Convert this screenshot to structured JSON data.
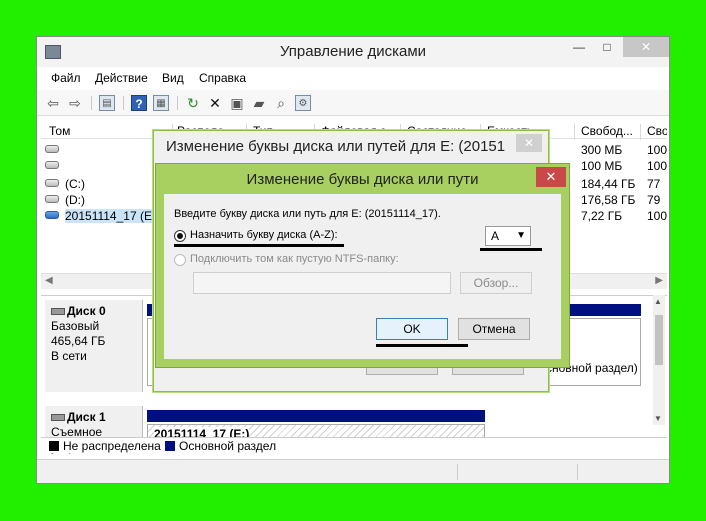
{
  "main_window": {
    "title": "Управление дисками",
    "menu": [
      "Файл",
      "Действие",
      "Вид",
      "Справка"
    ],
    "columns": [
      "Том",
      "Располо",
      "Тип",
      "Файловая с",
      "Состояние",
      "Емкость",
      "Свобод...",
      "Сво"
    ],
    "volumes": [
      {
        "name": "",
        "free": "300 МБ",
        "pct": "100"
      },
      {
        "name": "",
        "free": "100 МБ",
        "pct": "100"
      },
      {
        "name": "(C:)",
        "free": "184,44 ГБ",
        "pct": "77"
      },
      {
        "name": "(D:)",
        "free": "176,58 ГБ",
        "pct": "79"
      },
      {
        "name": "20151114_17 (E:)",
        "free": "7,22 ГБ",
        "pct": "100"
      }
    ],
    "disks": [
      {
        "title": "Диск 0",
        "type": "Базовый",
        "size": "465,64 ГБ",
        "state": "В сети",
        "part_fragment_1": "S",
        "part_fragment_2": "сновной раздел)"
      },
      {
        "title": "Диск 1",
        "type": "Съемное устрой",
        "partition": "20151114_17  (E:)"
      }
    ],
    "legend": [
      "Не распределена",
      "Основной раздел"
    ],
    "legend_colors": [
      "#000000",
      "#001080"
    ]
  },
  "outer_dialog": {
    "title": "Изменение буквы диска или путей для E: (20151",
    "ok_label": "OK",
    "cancel_label": "Отмена"
  },
  "inner_dialog": {
    "title": "Изменение буквы диска или пути",
    "prompt": "Введите букву диска или путь для E: (20151114_17).",
    "option_letter": "Назначить букву диска (A-Z):",
    "option_folder": "Подключить том как пустую NTFS-папку:",
    "selected_letter": "A",
    "browse_label": "Обзор...",
    "ok_label": "OK",
    "cancel_label": "Отмена"
  }
}
